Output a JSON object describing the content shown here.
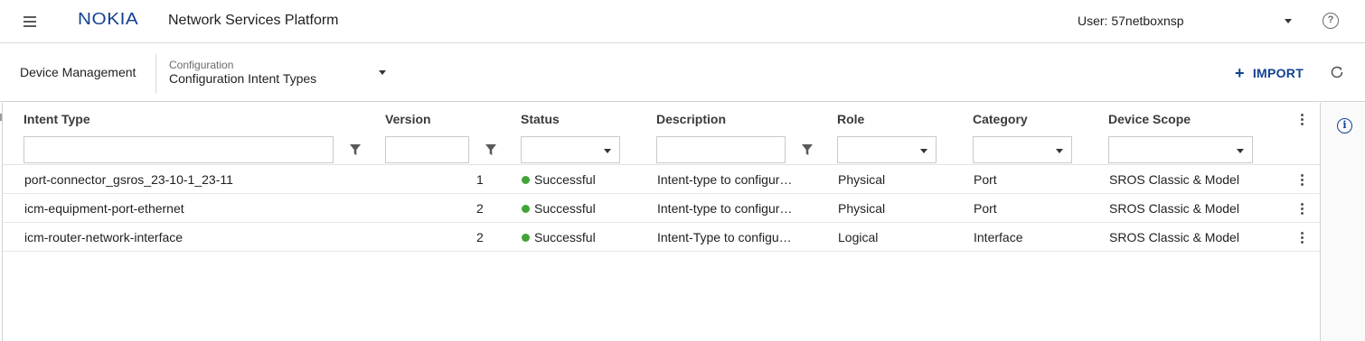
{
  "header": {
    "logo_text": "NOKIA",
    "app_title": "Network Services Platform",
    "user_label": "User: 57netboxnsp",
    "help_glyph": "?"
  },
  "subheader": {
    "root_label": "Device Management",
    "selector_caption": "Configuration",
    "selector_value": "Configuration Intent Types",
    "import_label": "IMPORT",
    "import_icon": "+"
  },
  "grid": {
    "columns": [
      "Intent Type",
      "Version",
      "Status",
      "Description",
      "Role",
      "Category",
      "Device Scope"
    ],
    "rows": [
      {
        "intent_type": "port-connector_gsros_23-10-1_23-11",
        "version": "1",
        "status": "Successful",
        "description": "Intent-type to configur…",
        "role": "Physical",
        "category": "Port",
        "device_scope": "SROS Classic & Model"
      },
      {
        "intent_type": "icm-equipment-port-ethernet",
        "version": "2",
        "status": "Successful",
        "description": "Intent-type to configur…",
        "role": "Physical",
        "category": "Port",
        "device_scope": "SROS Classic & Model"
      },
      {
        "intent_type": "icm-router-network-interface",
        "version": "2",
        "status": "Successful",
        "description": "Intent-Type to configu…",
        "role": "Logical",
        "category": "Interface",
        "device_scope": "SROS Classic & Model"
      }
    ]
  },
  "side_panel": {
    "info_glyph": "i"
  },
  "colors": {
    "brand": "#124191",
    "status_success": "#3fa535"
  }
}
